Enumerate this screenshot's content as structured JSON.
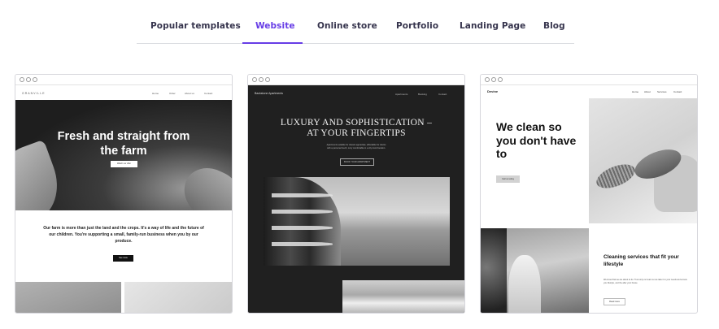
{
  "tabs": [
    {
      "label": "Popular templates",
      "active": false
    },
    {
      "label": "Website",
      "active": true
    },
    {
      "label": "Online store",
      "active": false
    },
    {
      "label": "Portfolio",
      "active": false
    },
    {
      "label": "Landing Page",
      "active": false
    },
    {
      "label": "Blog",
      "active": false
    }
  ],
  "accent_color": "#673de6",
  "templates": [
    {
      "brand": "GRANVILLE",
      "nav": [
        "Home",
        "Order",
        "About us",
        "Contact"
      ],
      "hero_title": "Fresh and straight from the farm",
      "hero_button": "Watch our offer",
      "paragraph": "Our farm is more than just the land and the crops. It's a way of life and the future of our children. You're supporting a small, family-run business when you by our produce.",
      "button": "See more"
    },
    {
      "brand": "Backstone Apartments",
      "nav": [
        "Apartments",
        "Booking",
        "Contact"
      ],
      "title": "LUXURY AND SOPHISTICATION – AT YOUR FINGERTIPS",
      "subtitle": "Apartments suitable for classic appreciate, affordable for clients with a personal touch, cozy comfortable in a city trend location.",
      "button": "BOOK YOUR APARTMENT"
    },
    {
      "brand": "Devine",
      "nav": [
        "Home",
        "About",
        "Services",
        "Contact"
      ],
      "title": "We clean so you don't have to",
      "button": "Call us today",
      "subtitle": "Cleaning services that fit your lifestyle",
      "text": "We know that we are about to do. Trust only our team so we take it to your needs and ensure you lifestyle, and the after your house.",
      "button2": "Read more"
    }
  ]
}
